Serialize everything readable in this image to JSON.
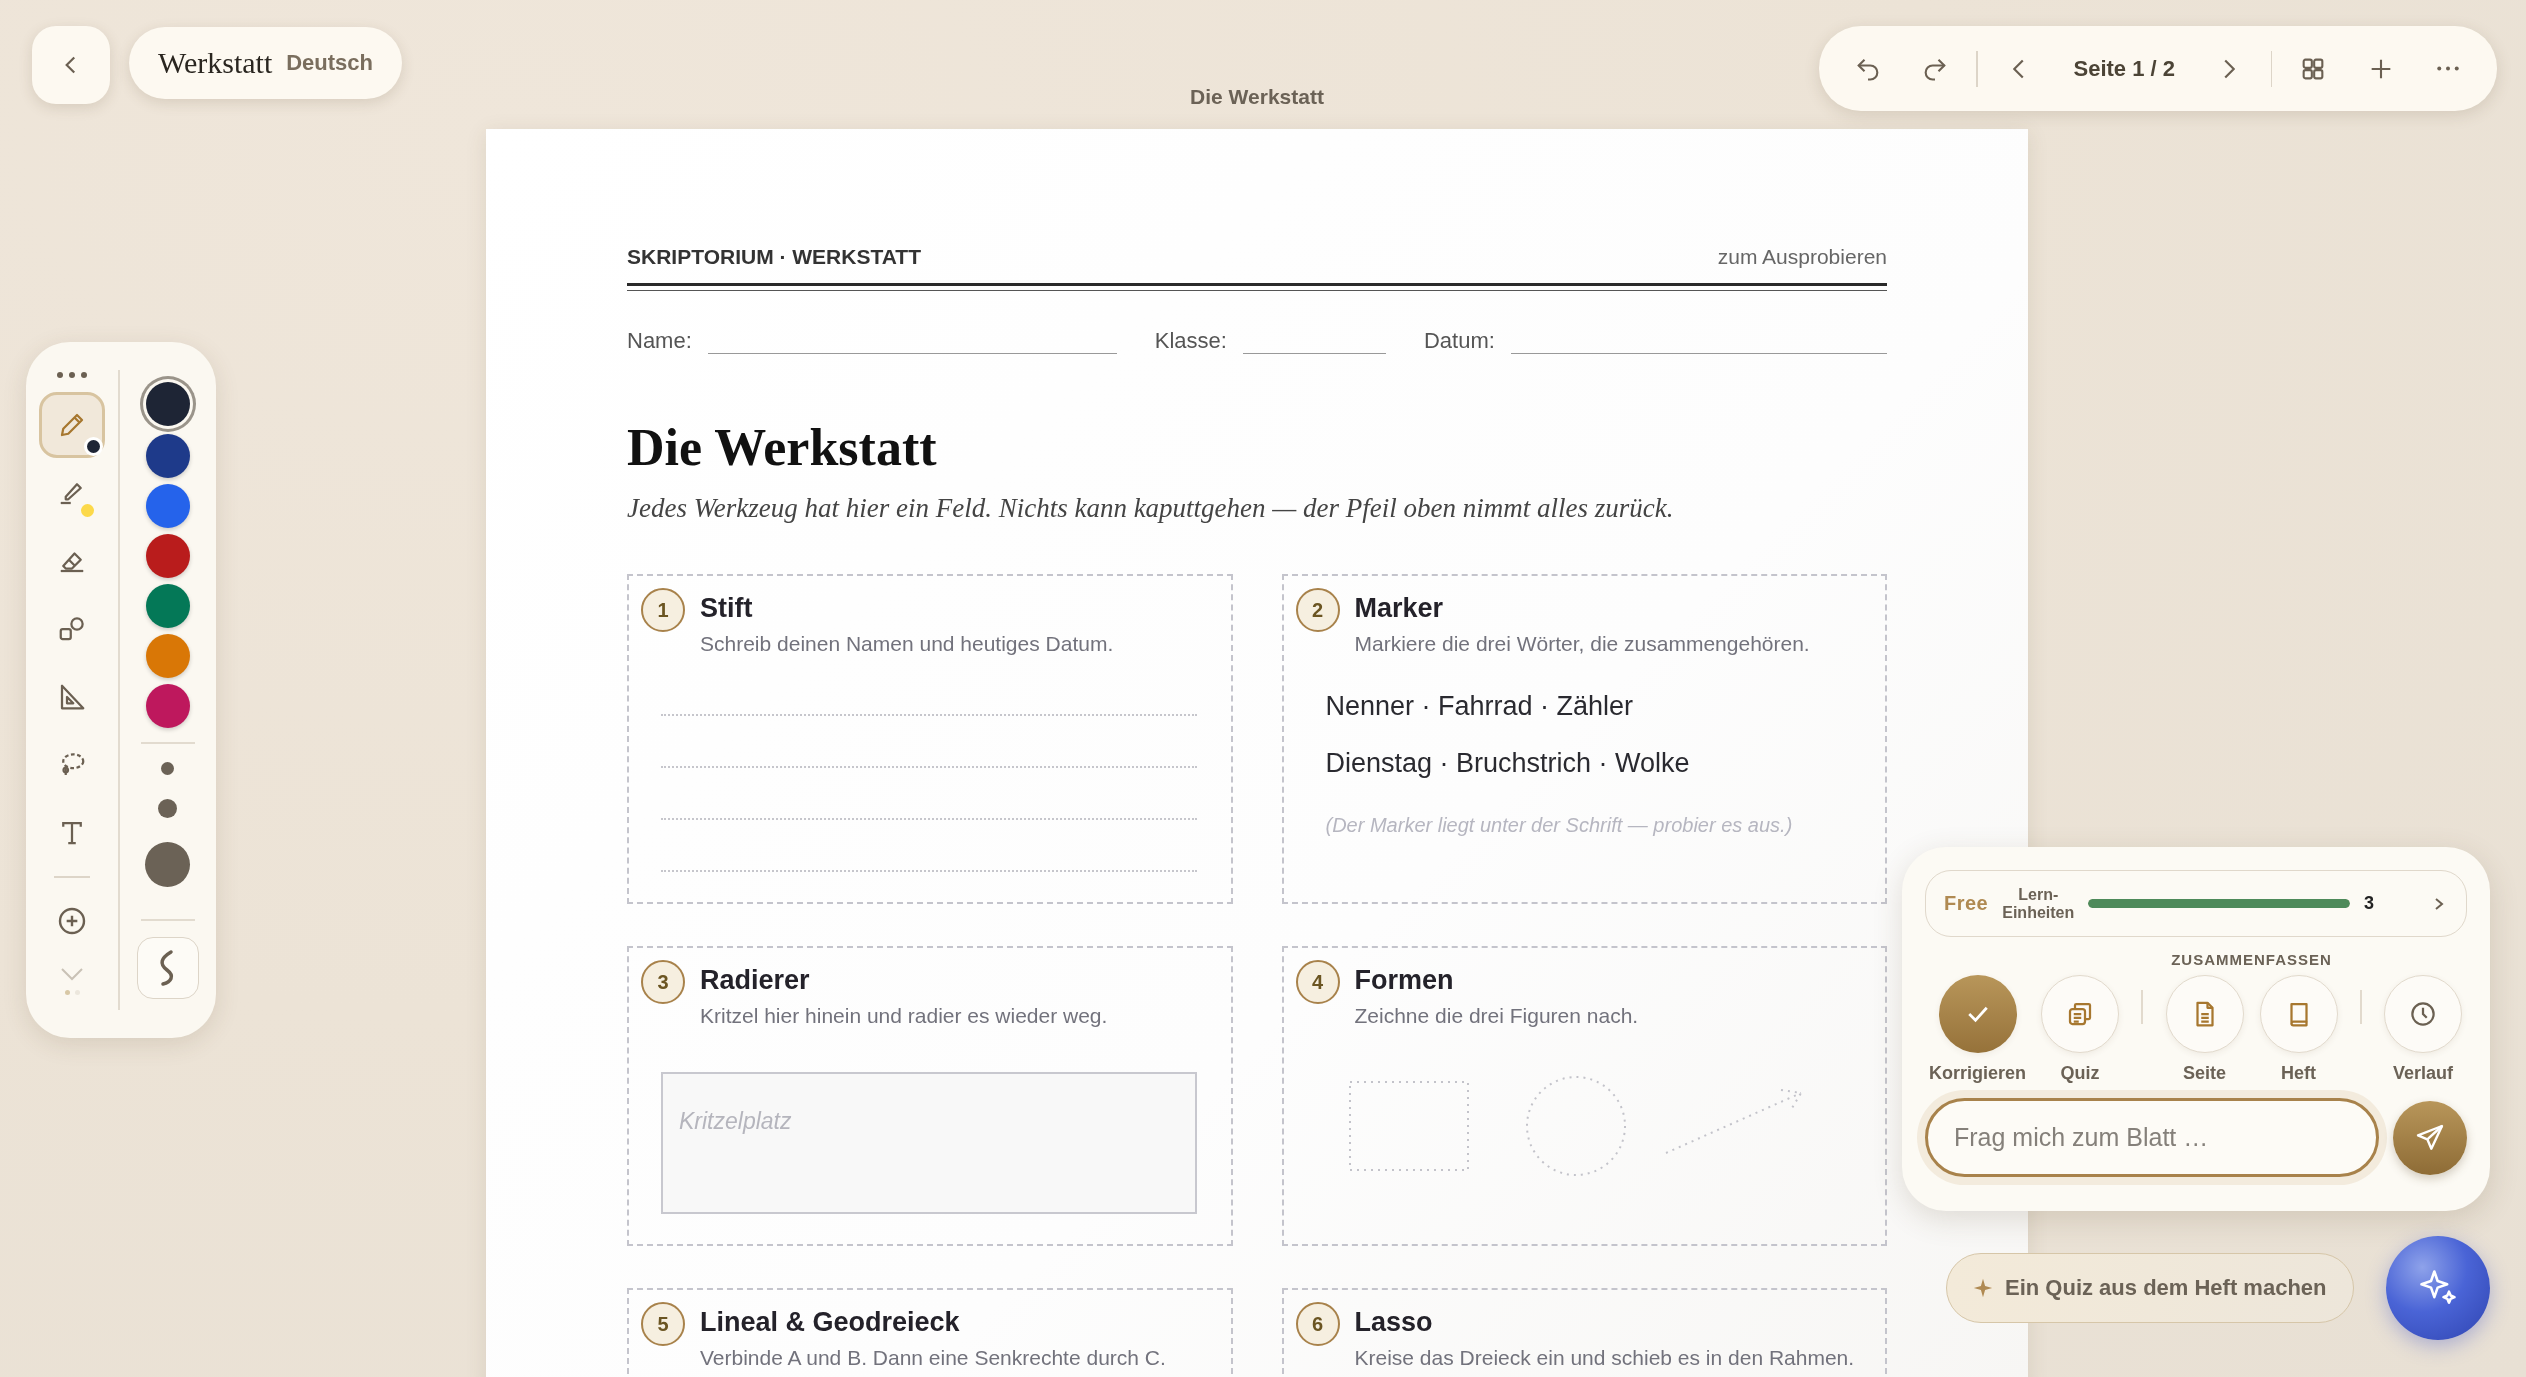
{
  "header": {
    "app_title": "Werkstatt",
    "subject": "Deutsch"
  },
  "document_title": "Die Werkstatt",
  "toolbar": {
    "page_label": "Seite 1 / 2"
  },
  "tools": [
    {
      "kind": "pen",
      "selected": true,
      "color": "#1e2535"
    },
    {
      "kind": "highlighter",
      "selected": false,
      "color": "#fcd94a"
    },
    {
      "kind": "eraser",
      "selected": false
    },
    {
      "kind": "shapes",
      "selected": false
    },
    {
      "kind": "ruler",
      "selected": false
    },
    {
      "kind": "lasso",
      "selected": false
    },
    {
      "kind": "text",
      "selected": false
    }
  ],
  "pager": [
    {
      "selected": true
    },
    {
      "selected": false
    }
  ],
  "colors": [
    {
      "color": "#1e2535",
      "selected": true
    },
    {
      "color": "#1e3a8a",
      "selected": false
    },
    {
      "color": "#2563eb",
      "selected": false
    },
    {
      "color": "#b91c1c",
      "selected": false
    },
    {
      "color": "#047857",
      "selected": false
    },
    {
      "color": "#d97706",
      "selected": false
    },
    {
      "color": "#be185d",
      "selected": false
    }
  ],
  "sizes": [
    {
      "kind": "small"
    },
    {
      "kind": "medium"
    },
    {
      "kind": "large"
    }
  ],
  "worksheet": {
    "header_left": "SKRIPTORIUM · WERKSTATT",
    "header_right": "zum Ausprobieren",
    "fields": [
      {
        "label": "Name:"
      },
      {
        "label": "Klasse:"
      },
      {
        "label": "Datum:"
      }
    ],
    "title": "Die Werkstatt",
    "subtitle": "Jedes Werkzeug hat hier ein Feld. Nichts kann kaputtgehen — der Pfeil oben nimmt alles zurück.",
    "tasks": [
      {
        "number": "1",
        "title": "Stift",
        "description": "Schreib deinen Namen und heutiges Datum.",
        "kind": "lines"
      },
      {
        "number": "2",
        "title": "Marker",
        "description": "Markiere die drei Wörter, die zusammengehören.",
        "kind": "words",
        "lines": [
          "Nenner · Fahrrad · Zähler",
          "Dienstag · Bruchstrich · Wolke"
        ],
        "note": "(Der Marker liegt unter der Schrift — probier es aus.)"
      },
      {
        "number": "3",
        "title": "Radierer",
        "description": "Kritzel hier hinein und radier es wieder weg.",
        "kind": "scribble",
        "placeholder": "Kritzelplatz"
      },
      {
        "number": "4",
        "title": "Formen",
        "description": "Zeichne die drei Figuren nach.",
        "kind": "shapes"
      },
      {
        "number": "5",
        "title": "Lineal & Geodreieck",
        "description": "Verbinde A und B. Dann eine Senkrechte durch C.",
        "kind": "plain"
      },
      {
        "number": "6",
        "title": "Lasso",
        "description": "Kreise das Dreieck ein und schieb es in den Rahmen.",
        "kind": "plain"
      }
    ]
  },
  "assistant": {
    "plan": "Free",
    "units_label": [
      "Lern-",
      "Einheiten"
    ],
    "level": 1,
    "count": "3",
    "action_groups": [
      {
        "items": [
          {
            "kind": "check",
            "label": "Korrigieren",
            "selected": true
          },
          {
            "kind": "cards",
            "label": "Quiz",
            "selected": false
          }
        ]
      },
      {
        "label": "ZUSAMMENFASSEN",
        "items": [
          {
            "kind": "page",
            "label": "Seite",
            "selected": false
          },
          {
            "kind": "book",
            "label": "Heft",
            "selected": false
          }
        ]
      },
      {
        "items": [
          {
            "kind": "clock",
            "label": "Verlauf",
            "selected": false
          }
        ]
      }
    ],
    "input": {
      "placeholder": "Frag mich zum Blatt …"
    },
    "suggestion": "Ein Quiz aus dem Heft machen"
  }
}
